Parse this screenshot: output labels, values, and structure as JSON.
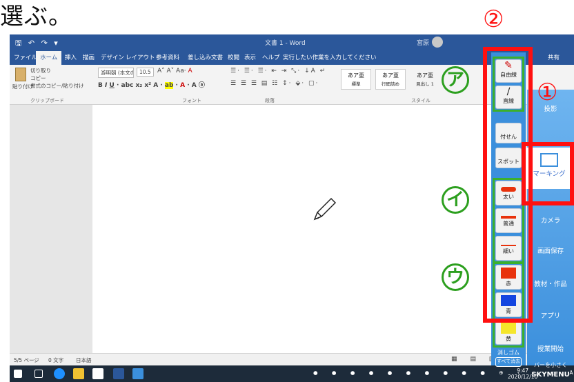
{
  "heading": "選ぶ。",
  "word": {
    "title": "文書 1 - Word",
    "user": "宮原",
    "menu": [
      "ファイル",
      "ホーム",
      "挿入",
      "描画",
      "デザイン",
      "レイアウト",
      "参考資料",
      "差し込み文書",
      "校閲",
      "表示",
      "ヘルプ",
      "実行したい作業を入力してください",
      "共有"
    ],
    "clipboard": {
      "cut": "切り取り",
      "copy": "コピー",
      "paste": "貼り付け",
      "format": "書式のコピー/貼り付け",
      "label": "クリップボード"
    },
    "font": {
      "name": "游明朝 (本文の",
      "size": "10.5",
      "label": "フォント"
    },
    "paragraph_label": "段落",
    "styles": {
      "label": "スタイル",
      "items": [
        {
          "sample": "あア亜",
          "name": "標準"
        },
        {
          "sample": "あア亜",
          "name": "行間詰め"
        },
        {
          "sample": "あア亜",
          "name": "見出し 1"
        }
      ]
    },
    "status": {
      "page": "5/5 ページ",
      "words": "0 文字",
      "lang": "日本語"
    },
    "clock": {
      "time": "9:47",
      "date": "2020/12/10"
    }
  },
  "skymenu": {
    "left_buttons": [
      "自由線",
      "直線",
      "付せん",
      "スポット",
      "太い",
      "普通",
      "細い",
      "赤",
      "青",
      "黄",
      "消しゴム",
      "すべて消去"
    ],
    "right_buttons": [
      "投影",
      "マーキング",
      "カメラ",
      "画面保存",
      "教材・作品",
      "アプリ",
      "授業開始",
      "バーを小さく",
      "SKYMENU"
    ],
    "colors": {
      "red": "#e8320c",
      "blue": "#1546e0",
      "yellow": "#f5e62a",
      "highlight_red": "#ff1010",
      "highlight_green": "#3cb02c"
    }
  },
  "annotations": {
    "circle1": "①",
    "circle2": "②",
    "katakana_a": "ア",
    "katakana_i": "イ",
    "katakana_u": "ウ"
  }
}
